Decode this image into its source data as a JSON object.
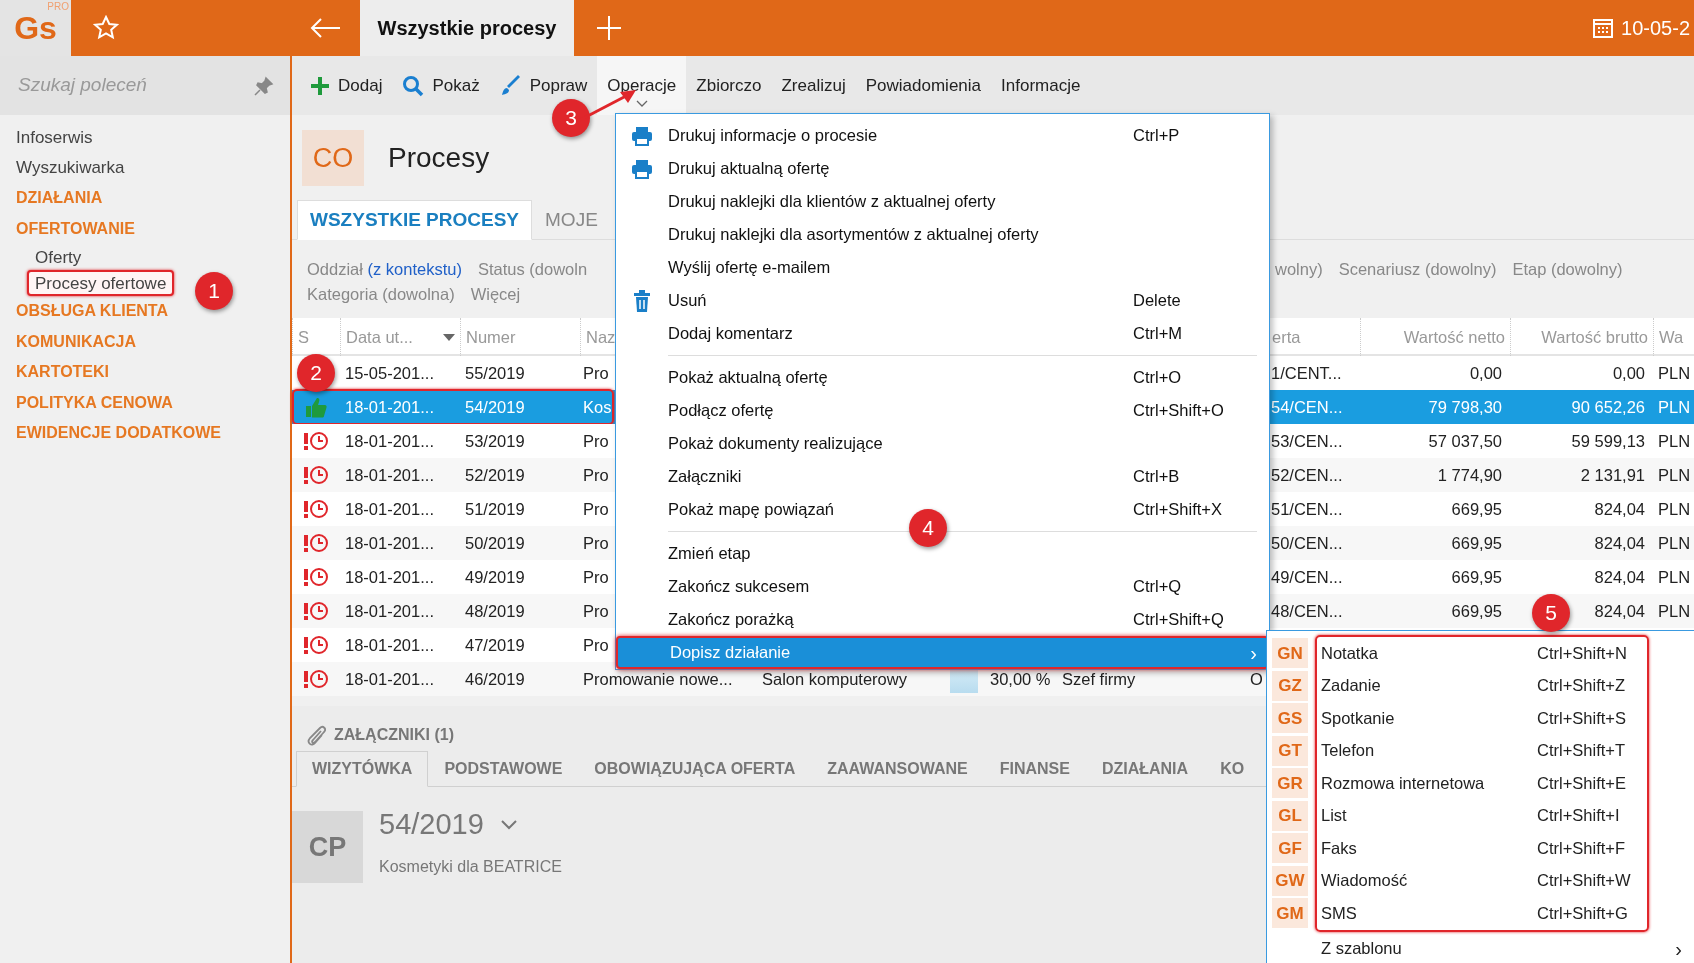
{
  "topbar": {
    "logo": "Gs",
    "logo_badge": "PRO",
    "active_tab": "Wszystkie procesy",
    "date": "10-05-2"
  },
  "sidebar": {
    "search": {
      "placeholder": "Szukaj poleceń"
    },
    "items": [
      {
        "kind": "link",
        "label": "Infoserwis"
      },
      {
        "kind": "link",
        "label": "Wyszukiwarka"
      },
      {
        "kind": "section",
        "label": "DZIAŁANIA"
      },
      {
        "kind": "section",
        "label": "OFERTOWANIE",
        "children": [
          {
            "label": "Oferty",
            "selected": false
          },
          {
            "label": "Procesy ofertowe",
            "selected": true
          }
        ]
      },
      {
        "kind": "section",
        "label": "OBSŁUGA KLIENTA"
      },
      {
        "kind": "section",
        "label": "KOMUNIKACJA"
      },
      {
        "kind": "section",
        "label": "KARTOTEKI"
      },
      {
        "kind": "section",
        "label": "POLITYKA CENOWA"
      },
      {
        "kind": "section",
        "label": "EWIDENCJE DODATKOWE"
      }
    ]
  },
  "toolbar": [
    {
      "kind": "add",
      "label": "Dodaj",
      "selected": false
    },
    {
      "kind": "view",
      "label": "Pokaż",
      "selected": false
    },
    {
      "kind": "edit",
      "label": "Popraw",
      "selected": false
    },
    {
      "kind": "menu",
      "label": "Operacje",
      "selected": true
    },
    {
      "kind": "menu",
      "label": "Zbiorczo",
      "selected": false
    },
    {
      "kind": "menu",
      "label": "Zrealizuj",
      "selected": false
    },
    {
      "kind": "menu",
      "label": "Powiadomienia",
      "selected": false
    },
    {
      "kind": "menu",
      "label": "Informacje",
      "selected": false
    }
  ],
  "page_header": {
    "badge": "CO",
    "title": "Procesy"
  },
  "tabs": [
    {
      "label": "WSZYSTKIE PROCESY",
      "selected": true
    },
    {
      "label": "MOJE",
      "selected": false
    }
  ],
  "filters": {
    "row_1": [
      {
        "label": "Oddział",
        "value": "(z kontekstu)"
      },
      {
        "label": "Status (dowoln"
      }
    ],
    "row_1_right": [
      {
        "label": "wolny)"
      },
      {
        "label": "Scenariusz (dowolny)"
      },
      {
        "label": "Etap (dowolny)"
      }
    ],
    "row_2": [
      {
        "label": "Kategoria (dowolna)"
      },
      {
        "label": "Więcej"
      }
    ]
  },
  "table": {
    "columns": {
      "status": {
        "label": "S",
        "sorted": false
      },
      "date": {
        "label": "Data ut...",
        "sorted": true
      },
      "number": {
        "label": "Numer",
        "sorted": false
      },
      "name": {
        "label": "Naz",
        "sorted": false
      },
      "offer": {
        "label": "erta",
        "sorted": false
      },
      "net": {
        "label": "Wartość netto",
        "sorted": false
      },
      "gross": {
        "label": "Wartość brutto",
        "sorted": false
      },
      "currency": {
        "label": "Wa",
        "sorted": false
      }
    },
    "rows": [
      {
        "kind": "none",
        "date": "15-05-201...",
        "number": "55/2019",
        "name": "Pro",
        "offer": "1/CENT...",
        "net": "0,00",
        "gross": "0,00",
        "currency": "PLN",
        "selected": false
      },
      {
        "kind": "won",
        "date": "18-01-201...",
        "number": "54/2019",
        "name": "Kos",
        "offer": "54/CEN...",
        "net": "79 798,30",
        "gross": "90 652,26",
        "currency": "PLN",
        "selected": true
      },
      {
        "kind": "overdue",
        "date": "18-01-201...",
        "number": "53/2019",
        "name": "Pro",
        "offer": "53/CEN...",
        "net": "57 037,50",
        "gross": "59 599,13",
        "currency": "PLN",
        "selected": false
      },
      {
        "kind": "overdue",
        "date": "18-01-201...",
        "number": "52/2019",
        "name": "Pro",
        "offer": "52/CEN...",
        "net": "1 774,90",
        "gross": "2 131,91",
        "currency": "PLN",
        "selected": false
      },
      {
        "kind": "overdue",
        "date": "18-01-201...",
        "number": "51/2019",
        "name": "Pro",
        "offer": "51/CEN...",
        "net": "669,95",
        "gross": "824,04",
        "currency": "PLN",
        "selected": false
      },
      {
        "kind": "overdue",
        "date": "18-01-201...",
        "number": "50/2019",
        "name": "Pro",
        "offer": "50/CEN...",
        "net": "669,95",
        "gross": "824,04",
        "currency": "PLN",
        "selected": false
      },
      {
        "kind": "overdue",
        "date": "18-01-201...",
        "number": "49/2019",
        "name": "Pro",
        "offer": "49/CEN...",
        "net": "669,95",
        "gross": "824,04",
        "currency": "PLN",
        "selected": false
      },
      {
        "kind": "overdue",
        "date": "18-01-201...",
        "number": "48/2019",
        "name": "Pro",
        "offer": "48/CEN...",
        "net": "669,95",
        "gross": "824,04",
        "currency": "PLN",
        "selected": false
      },
      {
        "kind": "overdue",
        "date": "18-01-201...",
        "number": "47/2019",
        "name": "Pro",
        "selected": false
      },
      {
        "kind": "overdue",
        "date": "18-01-201...",
        "number": "46/2019",
        "name": "Promowanie nowe...",
        "customer": "Salon komputerowy",
        "progress": "30,00 %",
        "owner": "Szef firmy",
        "offer": "O",
        "selected": false
      }
    ]
  },
  "attachments": "ZAŁĄCZNIKI (1)",
  "detail_tabs": [
    {
      "label": "WIZYTÓWKA",
      "selected": true
    },
    {
      "label": "PODSTAWOWE",
      "selected": false
    },
    {
      "label": "OBOWIĄZUJĄCA OFERTA",
      "selected": false
    },
    {
      "label": "ZAAWANSOWANE",
      "selected": false
    },
    {
      "label": "FINANSE",
      "selected": false
    },
    {
      "label": "DZIAŁANIA",
      "selected": false
    },
    {
      "label": "KO",
      "selected": false
    }
  ],
  "detail": {
    "badge": "CP",
    "number": "54/2019",
    "subtitle": "Kosmetyki dla BEATRICE"
  },
  "operations_menu": [
    {
      "kind": "print",
      "label": "Drukuj informacje o procesie",
      "shortcut": "Ctrl+P",
      "selected": false
    },
    {
      "kind": "print",
      "label": "Drukuj aktualną ofertę",
      "selected": false
    },
    {
      "kind": "plain",
      "label": "Drukuj naklejki dla klientów z aktualnej oferty",
      "selected": false
    },
    {
      "kind": "plain",
      "label": "Drukuj naklejki dla asortymentów z aktualnej oferty",
      "selected": false
    },
    {
      "kind": "plain",
      "label": "Wyślij ofertę e-mailem",
      "selected": false
    },
    {
      "kind": "delete",
      "label": "Usuń",
      "shortcut": "Delete",
      "selected": false
    },
    {
      "kind": "plain",
      "label": "Dodaj komentarz",
      "shortcut": "Ctrl+M",
      "selected": false
    },
    {
      "kind": "separator"
    },
    {
      "kind": "plain",
      "label": "Pokaż aktualną ofertę",
      "shortcut": "Ctrl+O",
      "selected": false
    },
    {
      "kind": "plain",
      "label": "Podłącz ofertę",
      "shortcut": "Ctrl+Shift+O",
      "selected": false
    },
    {
      "kind": "plain",
      "label": "Pokaż dokumenty realizujące",
      "selected": false
    },
    {
      "kind": "plain",
      "label": "Załączniki",
      "shortcut": "Ctrl+B",
      "selected": false
    },
    {
      "kind": "plain",
      "label": "Pokaż mapę powiązań",
      "shortcut": "Ctrl+Shift+X",
      "selected": false
    },
    {
      "kind": "separator"
    },
    {
      "kind": "plain",
      "label": "Zmień etap",
      "selected": false
    },
    {
      "kind": "plain",
      "label": "Zakończ sukcesem",
      "shortcut": "Ctrl+Q",
      "selected": false
    },
    {
      "kind": "plain",
      "label": "Zakończ porażką",
      "shortcut": "Ctrl+Shift+Q",
      "selected": false
    },
    {
      "kind": "submenu",
      "label": "Dopisz działanie",
      "arrow": "›",
      "selected": true
    }
  ],
  "activity_submenu": {
    "actions": [
      {
        "code": "GN",
        "label": "Notatka",
        "shortcut": "Ctrl+Shift+N"
      },
      {
        "code": "GZ",
        "label": "Zadanie",
        "shortcut": "Ctrl+Shift+Z"
      },
      {
        "code": "GS",
        "label": "Spotkanie",
        "shortcut": "Ctrl+Shift+S"
      },
      {
        "code": "GT",
        "label": "Telefon",
        "shortcut": "Ctrl+Shift+T"
      },
      {
        "code": "GR",
        "label": "Rozmowa internetowa",
        "shortcut": "Ctrl+Shift+E"
      },
      {
        "code": "GL",
        "label": "List",
        "shortcut": "Ctrl+Shift+I"
      },
      {
        "code": "GF",
        "label": "Faks",
        "shortcut": "Ctrl+Shift+F"
      },
      {
        "code": "GW",
        "label": "Wiadomość",
        "shortcut": "Ctrl+Shift+W"
      },
      {
        "code": "GM",
        "label": "SMS",
        "shortcut": "Ctrl+Shift+G"
      }
    ],
    "more": {
      "label": "Z szablonu",
      "arrow": "›"
    }
  },
  "annotations": [
    {
      "label": "1"
    },
    {
      "label": "2"
    },
    {
      "label": "3"
    },
    {
      "label": "4"
    },
    {
      "label": "5"
    }
  ]
}
